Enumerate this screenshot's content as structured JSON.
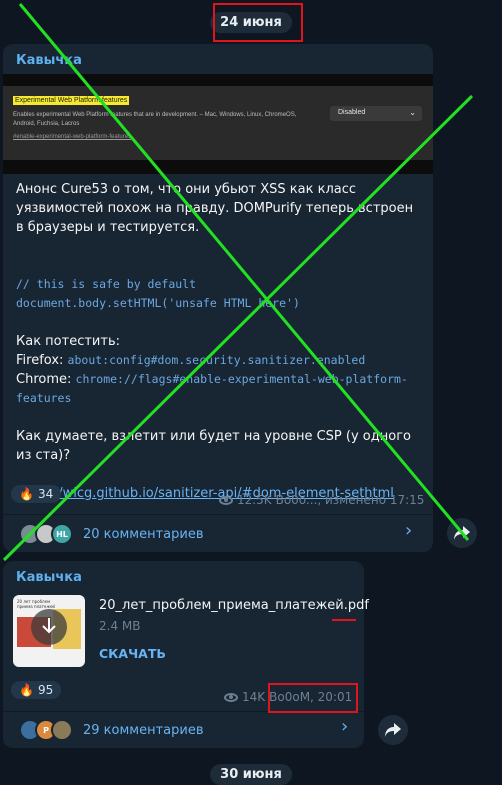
{
  "dates": {
    "top": "24 июня",
    "bottom": "30 июня"
  },
  "post1": {
    "sender": "Кавычка",
    "preview": {
      "title": "Experimental Web Platform features",
      "desc": "Enables experimental Web Platform features that are in development. – Mac, Windows, Linux, ChromeOS, Android, Fuchsia, Lacros",
      "link": "#enable-experimental-web-platform-features",
      "select": "Disabled"
    },
    "text": {
      "p1": "Анонс Cure53 о том, что они убьют XSS как класс уязвимостей похож на правду. DOMPurify теперь встроен в браузеры и тестируется.",
      "code1": "// this is safe by default",
      "code2": "document.body.setHTML('unsafe HTML here')",
      "how": "Как потестить:",
      "firefox_label": "Firefox: ",
      "firefox_value": "about:config#dom.security.sanitizer.enabled",
      "chrome_label": "Chrome: ",
      "chrome_value": "chrome://flags#enable-experimental-web-platform-features",
      "question": "Как думаете, взлетит или будет на уровне CSP (у одного из ста)?",
      "url": "https://wicg.github.io/sanitizer-api/#dom-element-sethtml"
    },
    "reaction": {
      "emoji": "🔥",
      "count": "34"
    },
    "views": "12.5K",
    "meta": "Bo0o..., изменено 17:15",
    "avatars": [
      "",
      "",
      "HL"
    ],
    "comments": "20 комментариев"
  },
  "post2": {
    "sender": "Кавычка",
    "doc_name": "20_лет_проблем_приема_платежей.pdf",
    "doc_size": "2.4 MB",
    "download": "СКАЧАТЬ",
    "thumb_title": "20 лет проблем приема платежей",
    "reaction": {
      "emoji": "🔥",
      "count": "95"
    },
    "views": "14K",
    "meta": "Bo0oM, 20:01",
    "avatars": [
      "",
      "P",
      ""
    ],
    "comments": "29 комментариев"
  },
  "colors": {
    "accent": "#6ab3f3",
    "highlight": "#e0151c",
    "cross": "#22e022"
  }
}
